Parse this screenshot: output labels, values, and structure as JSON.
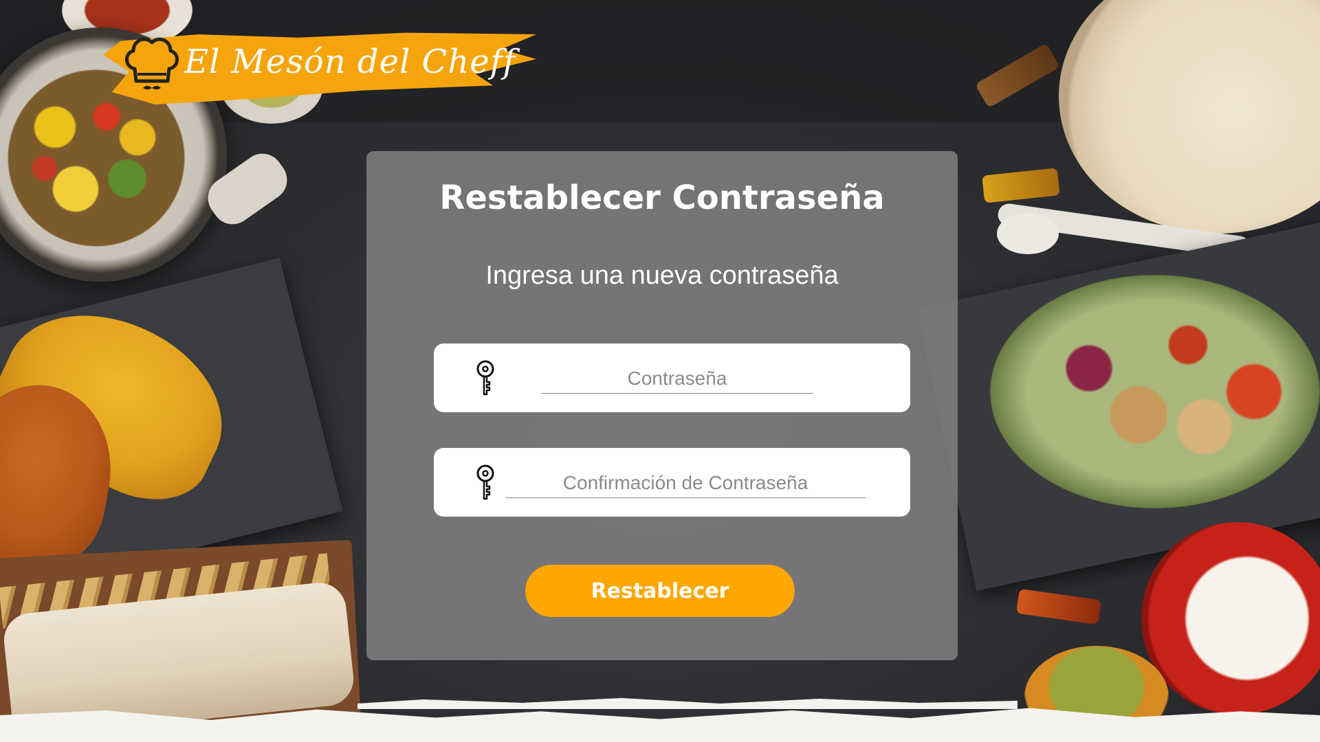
{
  "brand": {
    "name": "El Mesón del Cheff",
    "accent_color": "#ffa600"
  },
  "card": {
    "title": "Restablecer Contraseña",
    "subtitle": "Ingresa una nueva contraseña"
  },
  "form": {
    "password": {
      "placeholder": "Contraseña",
      "value": "",
      "icon": "key-icon"
    },
    "confirm_password": {
      "placeholder": "Confirmación de Contraseña",
      "value": "",
      "icon": "key-icon"
    },
    "submit_label": "Restablecer"
  }
}
